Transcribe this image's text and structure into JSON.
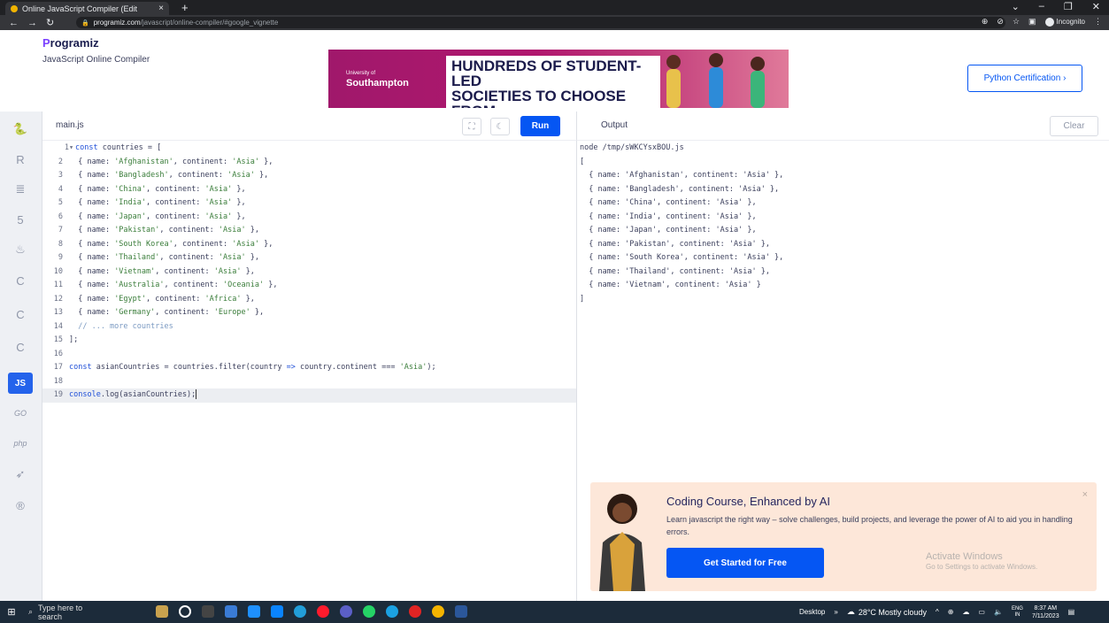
{
  "browser": {
    "tab_title": "Online JavaScript Compiler (Edit",
    "tab_close": "×",
    "new_tab": "+",
    "url_host": "programiz.com",
    "url_path": "/javascript/online-compiler/#google_vignette",
    "incognito_label": "Incognito"
  },
  "site": {
    "logo_first": "P",
    "logo_rest": "rogramiz",
    "subtitle": "JavaScript Online Compiler",
    "cert_button": "Python Certification ›",
    "ad": {
      "university_small": "University of",
      "university": "Southampton",
      "headline_1": "HUNDREDS OF STUDENT-LED",
      "headline_2": "SOCIETIES TO CHOOSE FROM"
    }
  },
  "sidebar": {
    "items": [
      {
        "icon": "python-icon",
        "glyph": "🐍"
      },
      {
        "icon": "r-icon",
        "glyph": "R"
      },
      {
        "icon": "sql-icon",
        "glyph": "≣"
      },
      {
        "icon": "html-icon",
        "glyph": "5"
      },
      {
        "icon": "java-icon",
        "glyph": "♨"
      },
      {
        "icon": "c-icon",
        "glyph": "C"
      },
      {
        "icon": "cpp-icon",
        "glyph": "C"
      },
      {
        "icon": "csharp-icon",
        "glyph": "C"
      },
      {
        "icon": "js-icon",
        "glyph": "JS"
      },
      {
        "icon": "go-icon",
        "glyph": "GO"
      },
      {
        "icon": "php-icon",
        "glyph": "php"
      },
      {
        "icon": "swift-icon",
        "glyph": "➶"
      },
      {
        "icon": "rust-icon",
        "glyph": "®"
      }
    ]
  },
  "editor": {
    "file_name": "main.js",
    "run_label": "Run",
    "lines": [
      {
        "n": "1",
        "fold": "▾",
        "tokens": [
          {
            "t": "k",
            "v": "const"
          },
          {
            "t": "p",
            "v": " countries = ["
          }
        ]
      },
      {
        "n": "2",
        "tokens": [
          {
            "t": "p",
            "v": "  { name: "
          },
          {
            "t": "s",
            "v": "'Afghanistan'"
          },
          {
            "t": "p",
            "v": ", continent: "
          },
          {
            "t": "s",
            "v": "'Asia'"
          },
          {
            "t": "p",
            "v": " },"
          }
        ]
      },
      {
        "n": "3",
        "tokens": [
          {
            "t": "p",
            "v": "  { name: "
          },
          {
            "t": "s",
            "v": "'Bangladesh'"
          },
          {
            "t": "p",
            "v": ", continent: "
          },
          {
            "t": "s",
            "v": "'Asia'"
          },
          {
            "t": "p",
            "v": " },"
          }
        ]
      },
      {
        "n": "4",
        "tokens": [
          {
            "t": "p",
            "v": "  { name: "
          },
          {
            "t": "s",
            "v": "'China'"
          },
          {
            "t": "p",
            "v": ", continent: "
          },
          {
            "t": "s",
            "v": "'Asia'"
          },
          {
            "t": "p",
            "v": " },"
          }
        ]
      },
      {
        "n": "5",
        "tokens": [
          {
            "t": "p",
            "v": "  { name: "
          },
          {
            "t": "s",
            "v": "'India'"
          },
          {
            "t": "p",
            "v": ", continent: "
          },
          {
            "t": "s",
            "v": "'Asia'"
          },
          {
            "t": "p",
            "v": " },"
          }
        ]
      },
      {
        "n": "6",
        "tokens": [
          {
            "t": "p",
            "v": "  { name: "
          },
          {
            "t": "s",
            "v": "'Japan'"
          },
          {
            "t": "p",
            "v": ", continent: "
          },
          {
            "t": "s",
            "v": "'Asia'"
          },
          {
            "t": "p",
            "v": " },"
          }
        ]
      },
      {
        "n": "7",
        "tokens": [
          {
            "t": "p",
            "v": "  { name: "
          },
          {
            "t": "s",
            "v": "'Pakistan'"
          },
          {
            "t": "p",
            "v": ", continent: "
          },
          {
            "t": "s",
            "v": "'Asia'"
          },
          {
            "t": "p",
            "v": " },"
          }
        ]
      },
      {
        "n": "8",
        "tokens": [
          {
            "t": "p",
            "v": "  { name: "
          },
          {
            "t": "s",
            "v": "'South Korea'"
          },
          {
            "t": "p",
            "v": ", continent: "
          },
          {
            "t": "s",
            "v": "'Asia'"
          },
          {
            "t": "p",
            "v": " },"
          }
        ]
      },
      {
        "n": "9",
        "tokens": [
          {
            "t": "p",
            "v": "  { name: "
          },
          {
            "t": "s",
            "v": "'Thailand'"
          },
          {
            "t": "p",
            "v": ", continent: "
          },
          {
            "t": "s",
            "v": "'Asia'"
          },
          {
            "t": "p",
            "v": " },"
          }
        ]
      },
      {
        "n": "10",
        "tokens": [
          {
            "t": "p",
            "v": "  { name: "
          },
          {
            "t": "s",
            "v": "'Vietnam'"
          },
          {
            "t": "p",
            "v": ", continent: "
          },
          {
            "t": "s",
            "v": "'Asia'"
          },
          {
            "t": "p",
            "v": " },"
          }
        ]
      },
      {
        "n": "11",
        "tokens": [
          {
            "t": "p",
            "v": "  { name: "
          },
          {
            "t": "s",
            "v": "'Australia'"
          },
          {
            "t": "p",
            "v": ", continent: "
          },
          {
            "t": "s",
            "v": "'Oceania'"
          },
          {
            "t": "p",
            "v": " },"
          }
        ]
      },
      {
        "n": "12",
        "tokens": [
          {
            "t": "p",
            "v": "  { name: "
          },
          {
            "t": "s",
            "v": "'Egypt'"
          },
          {
            "t": "p",
            "v": ", continent: "
          },
          {
            "t": "s",
            "v": "'Africa'"
          },
          {
            "t": "p",
            "v": " },"
          }
        ]
      },
      {
        "n": "13",
        "tokens": [
          {
            "t": "p",
            "v": "  { name: "
          },
          {
            "t": "s",
            "v": "'Germany'"
          },
          {
            "t": "p",
            "v": ", continent: "
          },
          {
            "t": "s",
            "v": "'Europe'"
          },
          {
            "t": "p",
            "v": " },"
          }
        ]
      },
      {
        "n": "14",
        "tokens": [
          {
            "t": "c",
            "v": "  // ... more countries"
          }
        ]
      },
      {
        "n": "15",
        "tokens": [
          {
            "t": "p",
            "v": "];"
          }
        ]
      },
      {
        "n": "16",
        "tokens": []
      },
      {
        "n": "17",
        "tokens": [
          {
            "t": "k",
            "v": "const"
          },
          {
            "t": "p",
            "v": " asianCountries = countries.filter(country "
          },
          {
            "t": "k",
            "v": "=>"
          },
          {
            "t": "p",
            "v": " country.continent === "
          },
          {
            "t": "s",
            "v": "'Asia'"
          },
          {
            "t": "p",
            "v": ");"
          }
        ]
      },
      {
        "n": "18",
        "tokens": []
      },
      {
        "n": "19",
        "highlight": true,
        "tokens": [
          {
            "t": "k",
            "v": "console"
          },
          {
            "t": "p",
            "v": ".log(asianCountries);"
          }
        ]
      }
    ]
  },
  "output": {
    "title": "Output",
    "clear_label": "Clear",
    "lines": [
      "node /tmp/sWKCYsxBOU.js",
      "[",
      "  { name: 'Afghanistan', continent: 'Asia' },",
      "  { name: 'Bangladesh', continent: 'Asia' },",
      "  { name: 'China', continent: 'Asia' },",
      "  { name: 'India', continent: 'Asia' },",
      "  { name: 'Japan', continent: 'Asia' },",
      "  { name: 'Pakistan', continent: 'Asia' },",
      "  { name: 'South Korea', continent: 'Asia' },",
      "  { name: 'Thailand', continent: 'Asia' },",
      "  { name: 'Vietnam', continent: 'Asia' }",
      "]"
    ]
  },
  "promo": {
    "title": "Coding Course, Enhanced by AI",
    "text": "Learn javascript the right way – solve challenges, build projects, and leverage the power of AI to aid you in handling errors.",
    "button": "Get Started for Free",
    "close": "×"
  },
  "watermark": {
    "line1": "Activate Windows",
    "line2": "Go to Settings to activate Windows."
  },
  "taskbar": {
    "search_placeholder": "Type here to search",
    "desktop_label": "Desktop",
    "weather": "28°C  Mostly cloudy",
    "lang_1": "ENG",
    "lang_2": "IN",
    "time": "8:37 AM",
    "date": "7/11/2023"
  }
}
